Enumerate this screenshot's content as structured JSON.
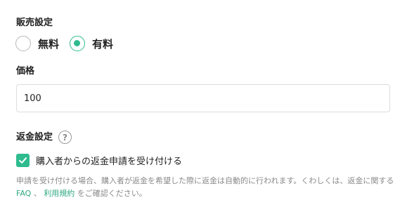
{
  "sales": {
    "title": "販売設定",
    "options": [
      {
        "label": "無料",
        "selected": false
      },
      {
        "label": "有料",
        "selected": true
      }
    ]
  },
  "price": {
    "title": "価格",
    "value": "100"
  },
  "refund": {
    "title": "返金設定",
    "help_icon": "?",
    "checkbox_label": "購入者からの返金申請を受け付ける",
    "checked": true,
    "note_prefix": "申請を受け付ける場合、購入者が返金を希望した際に返金は自動的に行われます。くわしくは、返金に関する",
    "faq_link": "FAQ",
    "separator": "、",
    "terms_link": "利用規約",
    "note_suffix": "をご確認ください。"
  },
  "colors": {
    "accent": "#2fbb8e",
    "text": "#222222",
    "muted": "#8a8a8a",
    "border": "#dcdcdc"
  }
}
